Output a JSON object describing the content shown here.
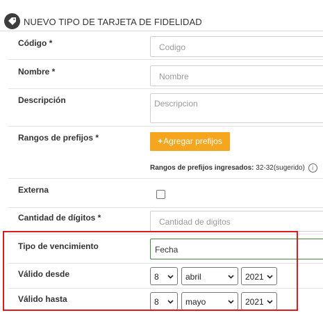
{
  "header": {
    "title": "NUEVO TIPO DE TARJETA DE FIDELIDAD",
    "icon": "tag-icon"
  },
  "form": {
    "codigo": {
      "label": "Código *",
      "placeholder": "Codigo"
    },
    "nombre": {
      "label": "Nombre *",
      "placeholder": "Nombre"
    },
    "descripcion": {
      "label": "Descripción",
      "placeholder": "Descripcion"
    },
    "rangos": {
      "label": "Rangos de prefijos *",
      "button_label": "Agregar prefijos",
      "button_icon": "+",
      "ingresados_label": "Rangos de prefijos ingresados:",
      "ingresados_value": "32-32(sugerido)",
      "info_icon": "i"
    },
    "externa": {
      "label": "Externa",
      "checked": false
    },
    "cantidad": {
      "label": "Cantidad de dígitos *",
      "placeholder": "Cantidad de digitos"
    },
    "tipo_vencimiento": {
      "label": "Tipo de vencimiento",
      "value": "Fecha"
    },
    "valido_desde": {
      "label": "Válido desde",
      "day": "8",
      "month": "abril",
      "year": "2021"
    },
    "valido_hasta": {
      "label": "Válido hasta",
      "day": "8",
      "month": "mayo",
      "year": "2021"
    }
  },
  "colors": {
    "accent_button": "#f5a51e",
    "highlight_border": "#e0191b",
    "focus_border": "#3c8c3c"
  }
}
